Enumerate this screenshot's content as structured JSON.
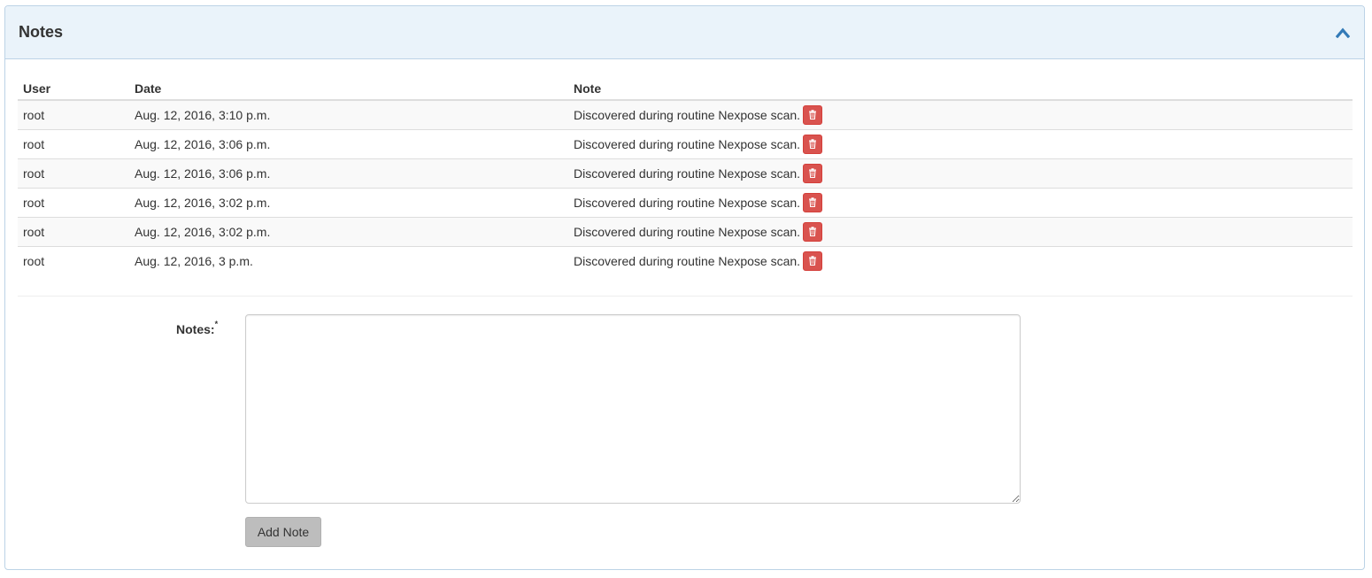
{
  "panel": {
    "title": "Notes",
    "collapse_icon": "chevron-up-icon",
    "accent_color": "#337ab7"
  },
  "table": {
    "headers": {
      "user": "User",
      "date": "Date",
      "note": "Note"
    },
    "rows": [
      {
        "user": "root",
        "date": "Aug. 12, 2016, 3:10 p.m.",
        "note": "Discovered during routine Nexpose scan."
      },
      {
        "user": "root",
        "date": "Aug. 12, 2016, 3:06 p.m.",
        "note": "Discovered during routine Nexpose scan."
      },
      {
        "user": "root",
        "date": "Aug. 12, 2016, 3:06 p.m.",
        "note": "Discovered during routine Nexpose scan."
      },
      {
        "user": "root",
        "date": "Aug. 12, 2016, 3:02 p.m.",
        "note": "Discovered during routine Nexpose scan."
      },
      {
        "user": "root",
        "date": "Aug. 12, 2016, 3:02 p.m.",
        "note": "Discovered during routine Nexpose scan."
      },
      {
        "user": "root",
        "date": "Aug. 12, 2016, 3 p.m.",
        "note": "Discovered during routine Nexpose scan."
      }
    ],
    "delete_icon": "trash-icon",
    "delete_color": "#d9534f"
  },
  "form": {
    "notes_label": "Notes:",
    "required_marker": "*",
    "notes_value": "",
    "add_button_label": "Add Note"
  }
}
